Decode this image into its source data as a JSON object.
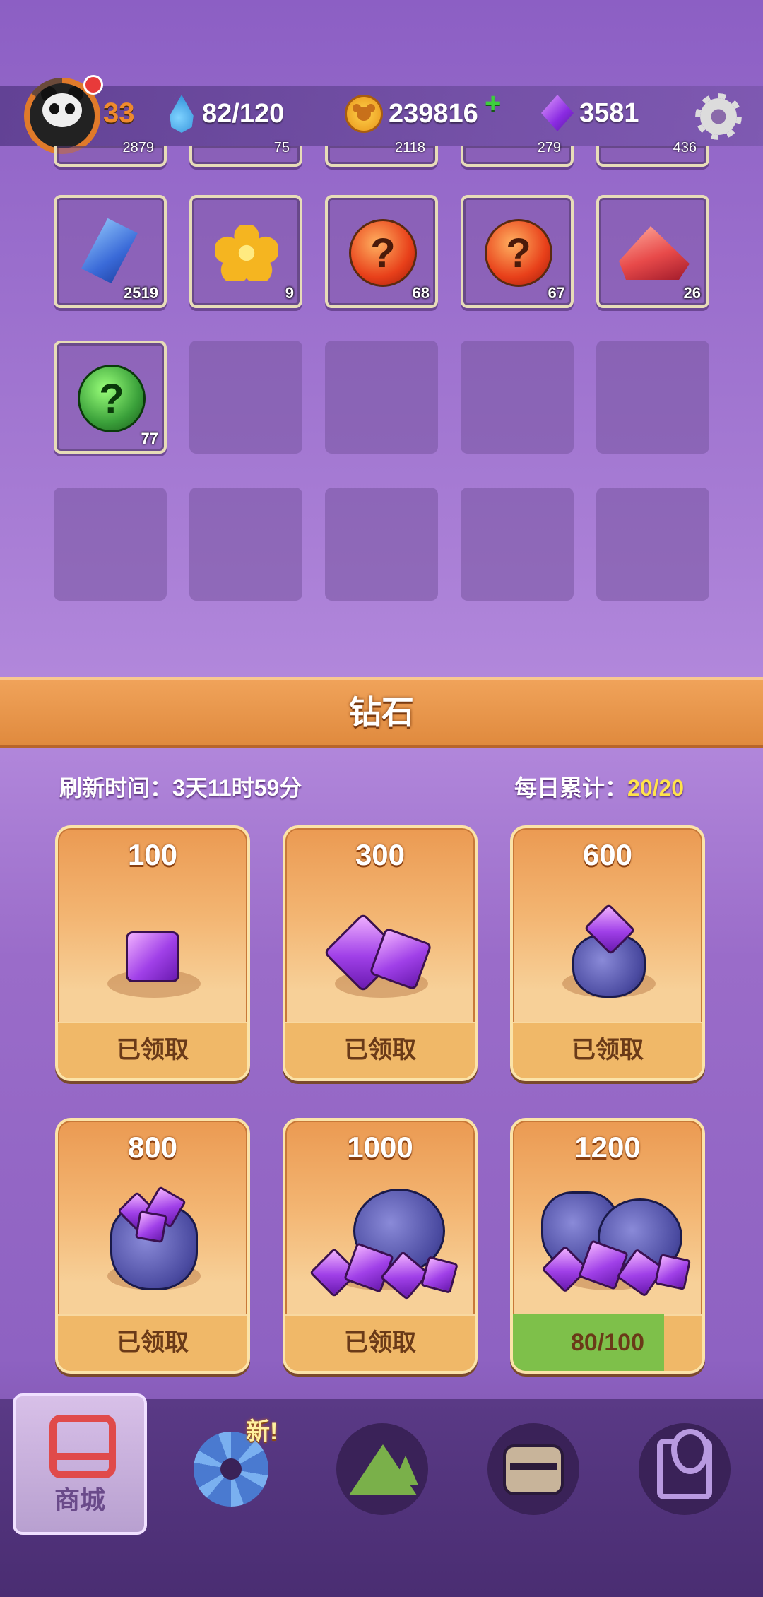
{
  "status_bar": {
    "level": "33",
    "energy": "82/120",
    "coins": "239816",
    "coins_plus": "+",
    "gems": "3581"
  },
  "inventory": {
    "top_partial_counts": [
      "2879",
      "75",
      "2118",
      "279",
      "436"
    ],
    "row2": [
      {
        "icon": "blue-crystal",
        "count": "2519"
      },
      {
        "icon": "golden-flower",
        "count": "9"
      },
      {
        "icon": "red-mystery-orb",
        "count": "68"
      },
      {
        "icon": "red-mystery-orb",
        "count": "67"
      },
      {
        "icon": "red-gem",
        "count": "26"
      }
    ],
    "row3": [
      {
        "icon": "green-mystery-orb",
        "count": "77"
      }
    ]
  },
  "section": {
    "title": "钻石",
    "refresh_label": "刷新时间：",
    "refresh_value": "3天11时59分",
    "daily_label": "每日累计：",
    "daily_value": "20/20"
  },
  "shop_items": [
    {
      "amount": "100",
      "status": "已领取",
      "icon": "single-gem"
    },
    {
      "amount": "300",
      "status": "已领取",
      "icon": "two-gems"
    },
    {
      "amount": "600",
      "status": "已领取",
      "icon": "gem-pouch"
    },
    {
      "amount": "800",
      "status": "已领取",
      "icon": "gem-sack"
    },
    {
      "amount": "1000",
      "status": "已领取",
      "icon": "large-gem-pile"
    },
    {
      "amount": "1200",
      "status": "80/100",
      "progress": 0.8,
      "icon": "huge-gem-pile"
    }
  ],
  "colors": {
    "accent_orange": "#e08a3e",
    "progress_green": "#7ec04a",
    "highlight_yellow": "#ffe34a"
  },
  "nav": {
    "shop_label": "商城",
    "new_badge": "新!",
    "items": [
      "shop-icon",
      "aperture-icon",
      "mountain-icon",
      "chest-icon",
      "map-pin-icon"
    ]
  }
}
